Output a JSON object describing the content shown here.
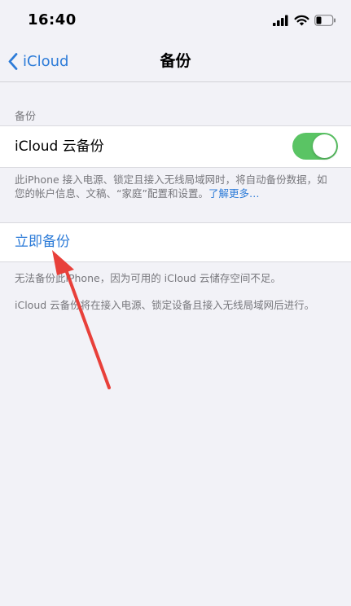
{
  "status_bar": {
    "time": "16:40",
    "icons": [
      "signal-icon",
      "wifi-icon",
      "battery-icon"
    ]
  },
  "nav": {
    "back_label": "iCloud",
    "title": "备份"
  },
  "section": {
    "header": "备份",
    "toggle_label": "iCloud 云备份",
    "toggle_on": true,
    "description": "此iPhone 接入电源、锁定且接入无线局域网时，将自动备份数据，如您的帐户信息、文稿、“家庭”配置和设置。",
    "learn_more": "了解更多…"
  },
  "action": {
    "label": "立即备份"
  },
  "notes": {
    "error": "无法备份此iPhone，因为可用的 iCloud 云储存空间不足。",
    "info": "iCloud 云备份将在接入电源、锁定设备且接入无线局域网后进行。"
  },
  "colors": {
    "accent": "#2c7bd8",
    "toggle_on": "#5ac464",
    "annotation_arrow": "#e8403a",
    "background": "#f2f2f7"
  }
}
